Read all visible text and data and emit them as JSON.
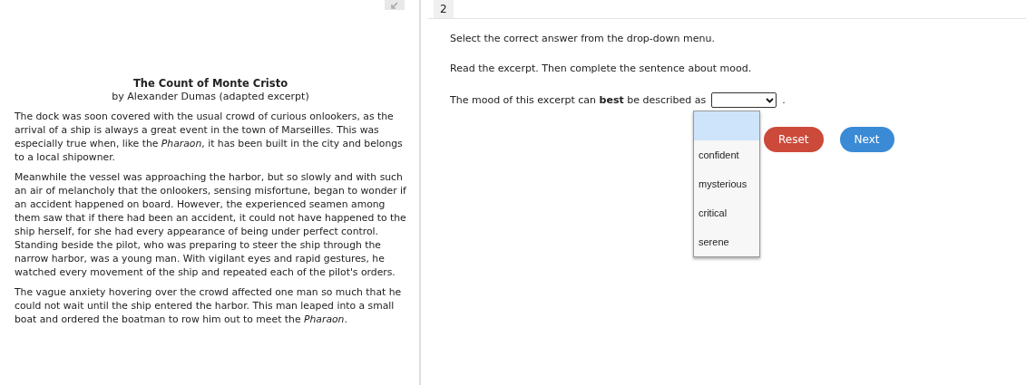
{
  "passage": {
    "title": "The Count of Monte Cristo",
    "byline": "by Alexander Dumas (adapted excerpt)",
    "paragraphs": [
      "The dock was soon covered with the usual crowd of curious onlookers, as the arrival of a ship is always a great event in the town of Marseilles. This was especially true when, like the *Pharaon*, it has been built in the city and belongs to a local shipowner.",
      "Meanwhile the vessel was approaching the harbor, but so slowly and with such an air of melancholy that the onlookers, sensing misfortune, began to wonder if an accident happened on board. However, the experienced seamen among them saw that if there had been an accident, it could not have happened to the ship herself, for she had every appearance of being under perfect control. Standing beside the pilot, who was preparing to steer the ship through the narrow harbor, was a young man. With vigilant eyes and rapid gestures, he watched every movement of the ship and repeated each of the pilot's orders.",
      "The vague anxiety hovering over the crowd affected one man so much that he could not wait until the ship entered the harbor. This man leaped into a small boat and ordered the boatman to row him out to meet the *Pharaon*."
    ]
  },
  "question": {
    "number": "2",
    "instruction": "Select the correct answer from the drop-down menu.",
    "prompt": "Read the excerpt. Then complete the sentence about mood.",
    "sentence": "The mood of this excerpt can **best** be described as",
    "end": ".",
    "dropdown": {
      "expanded": true,
      "blank_highlighted": true,
      "options": [
        {
          "label": "confident",
          "selected": false
        },
        {
          "label": "mysterious",
          "selected": false
        },
        {
          "label": "critical",
          "selected": false
        },
        {
          "label": "serene",
          "selected": false
        }
      ]
    }
  },
  "buttons": [
    {
      "label": "Reset",
      "kind": "reset"
    },
    {
      "label": "Next",
      "kind": "next"
    }
  ]
}
